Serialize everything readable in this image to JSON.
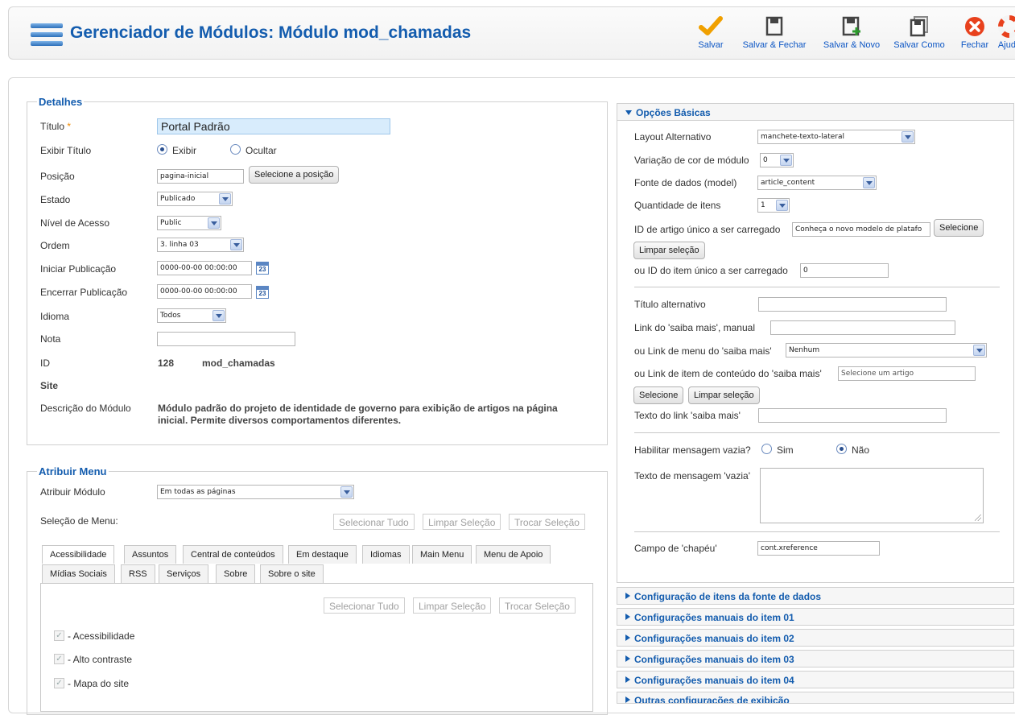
{
  "header": {
    "title": "Gerenciador de Módulos: Módulo mod_chamadas",
    "toolbar": [
      {
        "label": "Salvar",
        "icon": "checkmark-icon"
      },
      {
        "label": "Salvar & Fechar",
        "icon": "save-close-icon"
      },
      {
        "label": "Salvar & Novo",
        "icon": "save-new-icon"
      },
      {
        "label": "Salvar Como",
        "icon": "save-copy-icon"
      },
      {
        "label": "Fechar",
        "icon": "close-icon"
      },
      {
        "label": "Ajuda",
        "icon": "help-icon"
      }
    ]
  },
  "details": {
    "legend": "Detalhes",
    "title_label": "Título",
    "title_required": "*",
    "title_value": "Portal Padrão",
    "show_title_label": "Exibir Título",
    "show_option": "Exibir",
    "hide_option": "Ocultar",
    "position_label": "Posição",
    "position_value": "pagina-inicial",
    "position_button": "Selecione a posição",
    "state_label": "Estado",
    "state_value": "Publicado",
    "access_label": "Nível de Acesso",
    "access_value": "Public",
    "order_label": "Ordem",
    "order_value": "3. linha 03",
    "publish_up_label": "Iniciar Publicação",
    "publish_up_value": "0000-00-00 00:00:00",
    "publish_down_label": "Encerrar Publicação",
    "publish_down_value": "0000-00-00 00:00:00",
    "calendar_day": "23",
    "language_label": "Idioma",
    "language_value": "Todos",
    "note_label": "Nota",
    "note_value": "",
    "id_label": "ID",
    "id_value": "128",
    "module_name": "mod_chamadas",
    "site_label": "Site",
    "description_label": "Descrição do Módulo",
    "description_line1": "Módulo padrão do projeto de identidade de governo para exibição de artigos na página",
    "description_line2": "inicial. Permite diversos comportamentos diferentes."
  },
  "assign": {
    "legend": "Atribuir Menu",
    "module_label": "Atribuir Módulo",
    "module_value": "Em todas as páginas",
    "selection_label": "Seleção de Menu:",
    "select_all": "Selecionar Tudo",
    "clear_selection": "Limpar Seleção",
    "toggle_selection": "Trocar Seleção",
    "tabs_row1": [
      "Acessibilidade",
      "Assuntos",
      "Central de conteúdos",
      "Em destaque",
      "Idiomas",
      "Main Menu",
      "Menu de Apoio"
    ],
    "tabs_row2": [
      "Mídias Sociais",
      "RSS",
      "Serviços",
      "Sobre",
      "Sobre o site"
    ],
    "items": [
      "- Acessibilidade",
      "- Alto contraste",
      "- Mapa do site"
    ]
  },
  "basic": {
    "header": "Opções Básicas",
    "layout_label": "Layout Alternativo",
    "layout_value": "manchete-texto-lateral",
    "color_label": "Variação de cor de módulo",
    "color_value": "0",
    "source_label": "Fonte de dados (model)",
    "source_value": "article_content",
    "qty_label": "Quantidade de itens",
    "qty_value": "1",
    "article_label": "ID de artigo único a ser carregado",
    "article_value": "Conheça o novo modelo de platafo",
    "select_btn": "Selecione",
    "clear_btn": "Limpar seleção",
    "item_id_label": "ou ID do item único a ser carregado",
    "item_id_value": "0",
    "alt_title_label": "Título alternativo",
    "alt_title_value": "",
    "more_link_label": "Link do 'saiba mais', manual",
    "more_link_value": "",
    "menu_link_label": "ou Link de menu do 'saiba mais'",
    "menu_link_value": "Nenhum",
    "content_link_label": "ou Link de item de conteúdo do 'saiba mais'",
    "content_link_placeholder": "Selecione um artigo",
    "link_text_label": "Texto do link 'saiba mais'",
    "link_text_value": "",
    "empty_msg_label": "Habilitar mensagem vazia?",
    "yes_option": "Sim",
    "no_option": "Não",
    "empty_text_label": "Texto de mensagem 'vazia'",
    "hat_label": "Campo de 'chapéu'",
    "hat_value": "cont.xreference"
  },
  "accordion": [
    "Configuração de itens da fonte de dados",
    "Configurações manuais do item 01",
    "Configurações manuais do item 02",
    "Configurações manuais do item 03",
    "Configurações manuais do item 04",
    "Outras configurações de exibição"
  ],
  "colors": {
    "title_blue": "#135cae",
    "link_blue": "#0b55c4",
    "save_orange": "#f0a000",
    "close_red": "#e8411d"
  }
}
